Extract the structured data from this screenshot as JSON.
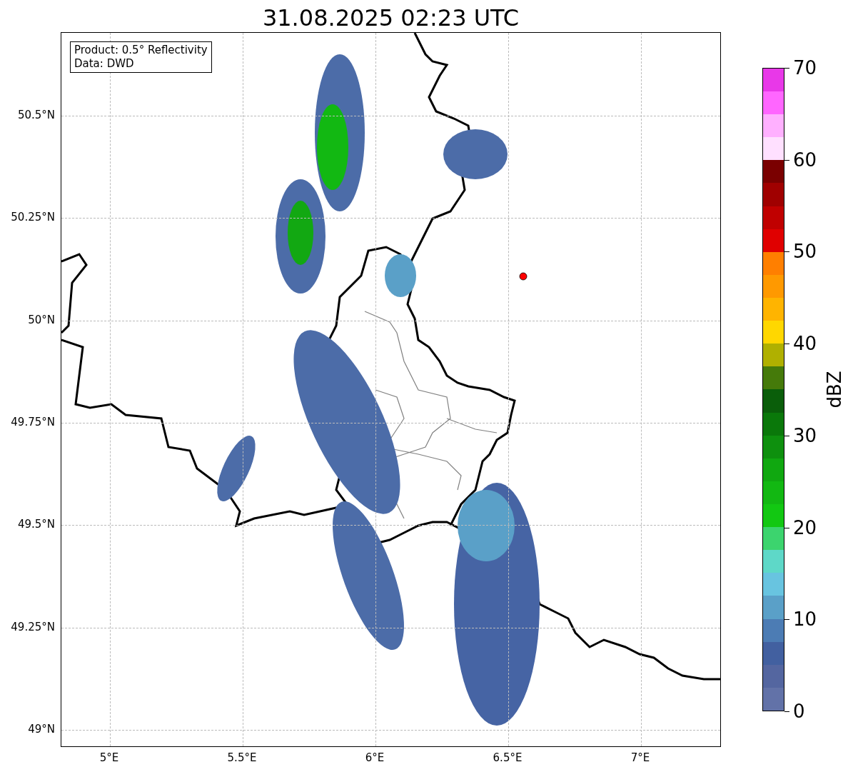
{
  "title": "31.08.2025 02:23 UTC",
  "legend": [
    "Product: 0.5° Reflectivity",
    "Data: DWD"
  ],
  "map": {
    "xticks": [
      "5°E",
      "5.5°E",
      "6°E",
      "6.5°E",
      "7°E"
    ],
    "yticks": [
      "50.5°N",
      "50.25°N",
      "50°N",
      "49.75°N",
      "49.5°N",
      "49.25°N",
      "49°N"
    ]
  },
  "colorbar": {
    "label": "dBZ",
    "ticks": [
      "70",
      "60",
      "50",
      "40",
      "30",
      "20",
      "10",
      "0"
    ],
    "bands": [
      {
        "color": "#6272a8"
      },
      {
        "color": "#5466a0"
      },
      {
        "color": "#4260a0"
      },
      {
        "color": "#4c7cb4"
      },
      {
        "color": "#5aa0c8"
      },
      {
        "color": "#68c4e0"
      },
      {
        "color": "#5ed8c8"
      },
      {
        "color": "#3cd46e"
      },
      {
        "color": "#12c812"
      },
      {
        "color": "#12b812"
      },
      {
        "color": "#10a810"
      },
      {
        "color": "#0e900e"
      },
      {
        "color": "#0a780a"
      },
      {
        "color": "#0a5e0a"
      },
      {
        "color": "#457a0a"
      },
      {
        "color": "#b0b000"
      },
      {
        "color": "#ffd700"
      },
      {
        "color": "#ffb400"
      },
      {
        "color": "#ff9900"
      },
      {
        "color": "#ff7f00"
      },
      {
        "color": "#e00000"
      },
      {
        "color": "#c00000"
      },
      {
        "color": "#a00000"
      },
      {
        "color": "#7a0000"
      },
      {
        "color": "#ffe0ff"
      },
      {
        "color": "#ffb0ff"
      },
      {
        "color": "#ff66ff"
      },
      {
        "color": "#e838e8"
      }
    ]
  }
}
